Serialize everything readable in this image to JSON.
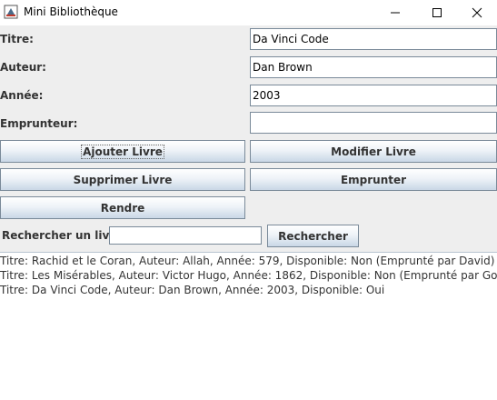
{
  "window": {
    "title": "Mini Bibliothèque"
  },
  "form": {
    "titre_label": "Titre:",
    "titre_value": "Da Vinci Code",
    "auteur_label": "Auteur:",
    "auteur_value": "Dan Brown",
    "annee_label": "Année:",
    "annee_value": "2003",
    "emprunteur_label": "Emprunteur:",
    "emprunteur_value": ""
  },
  "buttons": {
    "ajouter": "Ajouter Livre",
    "modifier": "Modifier Livre",
    "supprimer": "Supprimer Livre",
    "emprunter": "Emprunter",
    "rendre": "Rendre"
  },
  "search": {
    "label": "Rechercher un livre:",
    "value": "",
    "button": "Rechercher"
  },
  "results": [
    "Titre: Rachid et le Coran, Auteur: Allah, Année: 579, Disponible: Non (Emprunté par David)",
    "Titre: Les Misérables, Auteur: Victor Hugo, Année: 1862, Disponible: Non (Emprunté par Goliath)",
    "Titre: Da Vinci Code, Auteur: Dan Brown, Année: 2003, Disponible: Oui"
  ]
}
